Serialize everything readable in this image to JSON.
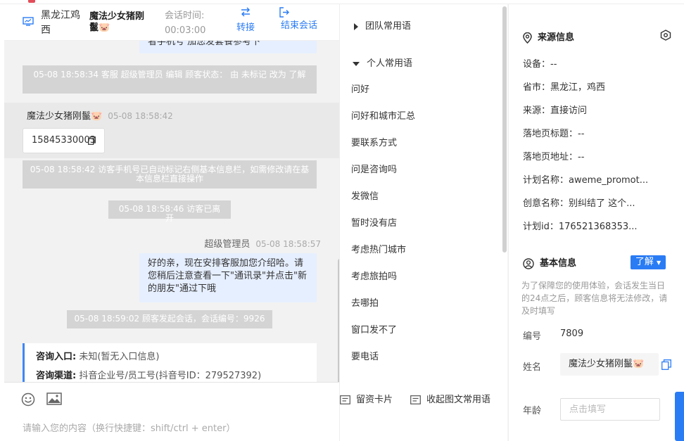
{
  "header": {
    "location": "黑龙江鸡西",
    "visitor_name": "魔法少女猪刚鬣🐷",
    "session_time_label": "会话时间:",
    "session_time_value": "00:03:00",
    "transfer_label": "转接",
    "end_label": "结束会话"
  },
  "messages": {
    "partial_staff_text": "者手机号 加您发套餐参考下",
    "sys1": "05-08 18:58:34 客服 超级管理员 编辑 顾客状态： 由 未标记 改为 了解",
    "visitor_name": "魔法少女猪刚鬣🐷",
    "visitor_time": "05-08 18:58:42",
    "visitor_phone": "15845330003",
    "sys2": "05-08 18:58:42 访客手机号已自动标记右侧基本信息栏，如需修改请在基本信息栏直接操作",
    "sys3": "05-08 18:58:46 访客已离开",
    "staff_name": "超级管理员",
    "staff_time": "05-08 18:58:57",
    "staff_text": "好的亲，现在安排客服加您介绍哈。请您稍后注意查看一下\"通讯录\"并点击\"新的朋友\"通过下哦",
    "sys4": "05-08 18:59:02 顾客发起会话，会话编号：9926",
    "entry_label": "咨询入口:",
    "entry_value": "未知(暂无入口信息)",
    "channel_label": "咨询渠道:",
    "channel_value": "抖音企业号/员工号(抖音号ID：279527392)"
  },
  "input": {
    "placeholder": "请输入您的内容（换行快捷键：shift/ctrl + enter）"
  },
  "phrases": {
    "team_group": "团队常用语",
    "personal_group": "个人常用语",
    "items": [
      "问好",
      "问好和城市汇总",
      "要联系方式",
      "问是咨询吗",
      "发微信",
      "暂时没有店",
      "考虑热门城市",
      "考虑旅拍吗",
      "去哪拍",
      "窗口发不了",
      "要电话"
    ],
    "card_label": "留资卡片",
    "collapse_label": "收起图文常用语"
  },
  "source_info": {
    "title": "来源信息",
    "device": "设备：--",
    "province_city": "省市：黑龙江，鸡西",
    "source": "来源：直接访问",
    "landing_title": "落地页标题：--",
    "landing_url": "落地页地址：--",
    "plan_name": "计划名称：aweme_promot...",
    "creative_name": "创意名称：别纠结了 这个...",
    "plan_id": "计划id：176521368353..."
  },
  "basic_info": {
    "title": "基本信息",
    "status_badge": "了解",
    "notice": "为了保障您的使用体验，会话发生当日的24点之后，顾客信息将无法修改，请及时填写",
    "id_label": "编号",
    "id_value": "7809",
    "name_label": "姓名",
    "name_value": "魔法少女猪刚鬣🐷",
    "age_label": "年龄",
    "age_placeholder": "点击填写"
  },
  "colors": {
    "accent": "#2a7cf5",
    "system_msg": "#d4d4d4",
    "staff_bubble": "#e6efff"
  }
}
